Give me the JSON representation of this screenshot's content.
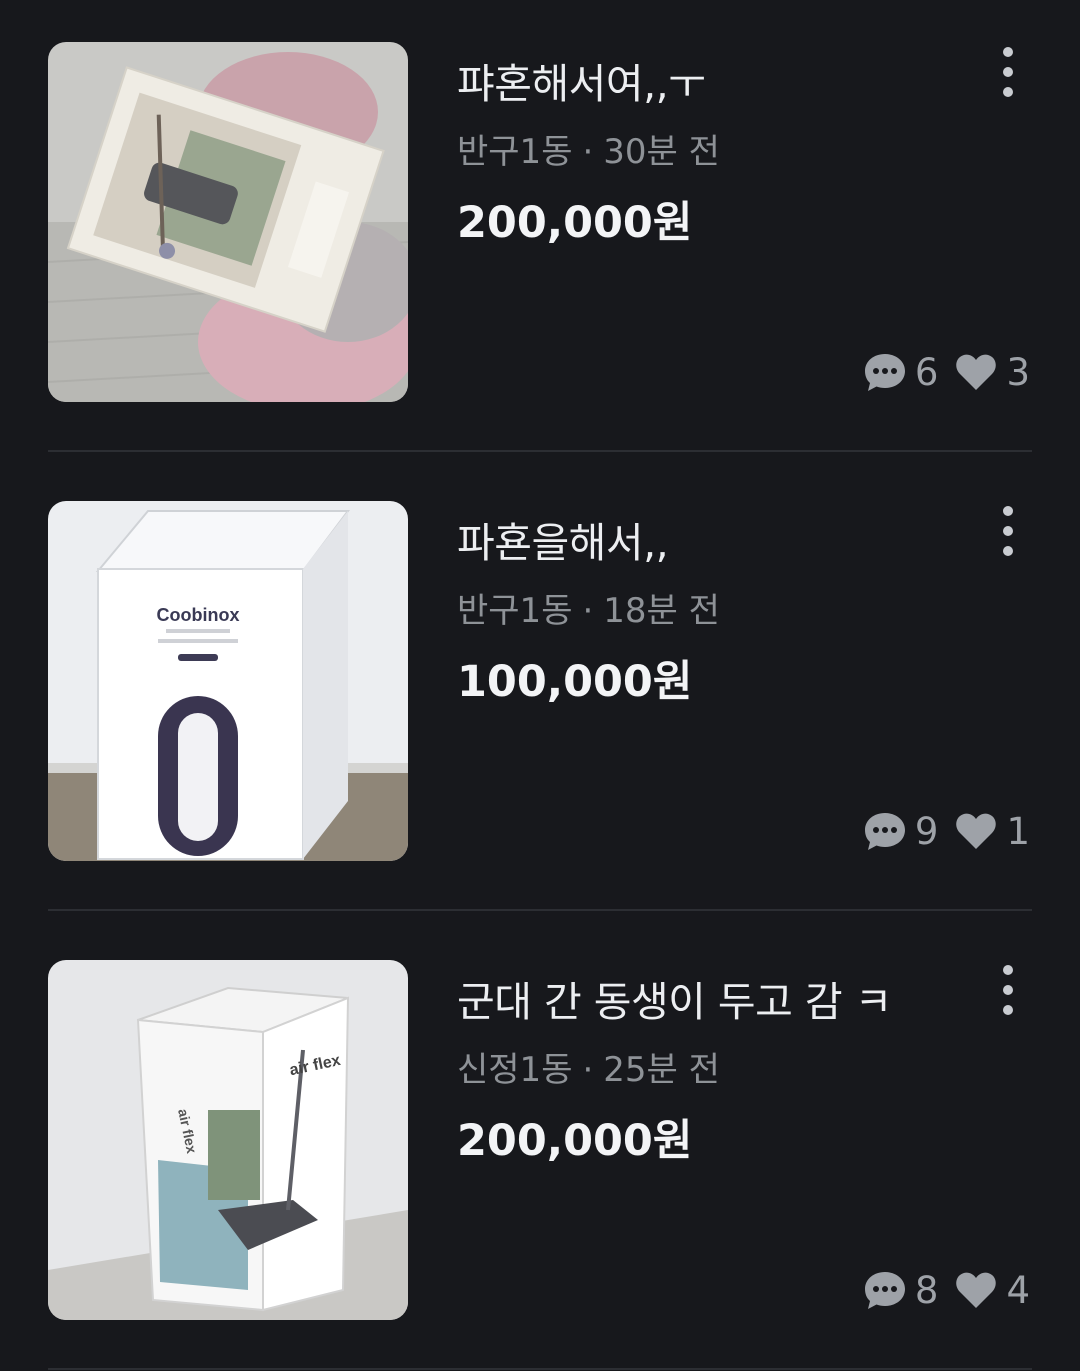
{
  "listings": [
    {
      "title": "퍄혼해서여,,ㅜ",
      "location": "반구1동",
      "separator": "·",
      "time": "30분 전",
      "price": "200,000원",
      "chats": "6",
      "likes": "3",
      "image": "air-flex-vacuum-box-photo"
    },
    {
      "title": "파횬을해서,,",
      "location": "반구1동",
      "separator": "·",
      "time": "18분 전",
      "price": "100,000원",
      "chats": "9",
      "likes": "1",
      "image": "coobinox-tower-fan-box-photo",
      "image_brand_text": "Coobinox"
    },
    {
      "title": "군대 간 동생이 두고 감 ㅋ",
      "location": "신정1동",
      "separator": "·",
      "time": "25분 전",
      "price": "200,000원",
      "chats": "8",
      "likes": "4",
      "image": "air-flex-vacuum-box-photo"
    }
  ],
  "icons": {
    "more": "more-vertical-icon",
    "chat": "chat-bubble-icon",
    "like": "heart-icon"
  },
  "colors": {
    "background": "#17181c",
    "title": "#eceef1",
    "meta": "#8e9297",
    "price": "#f3f4f6",
    "divider": "#2c2e33"
  }
}
